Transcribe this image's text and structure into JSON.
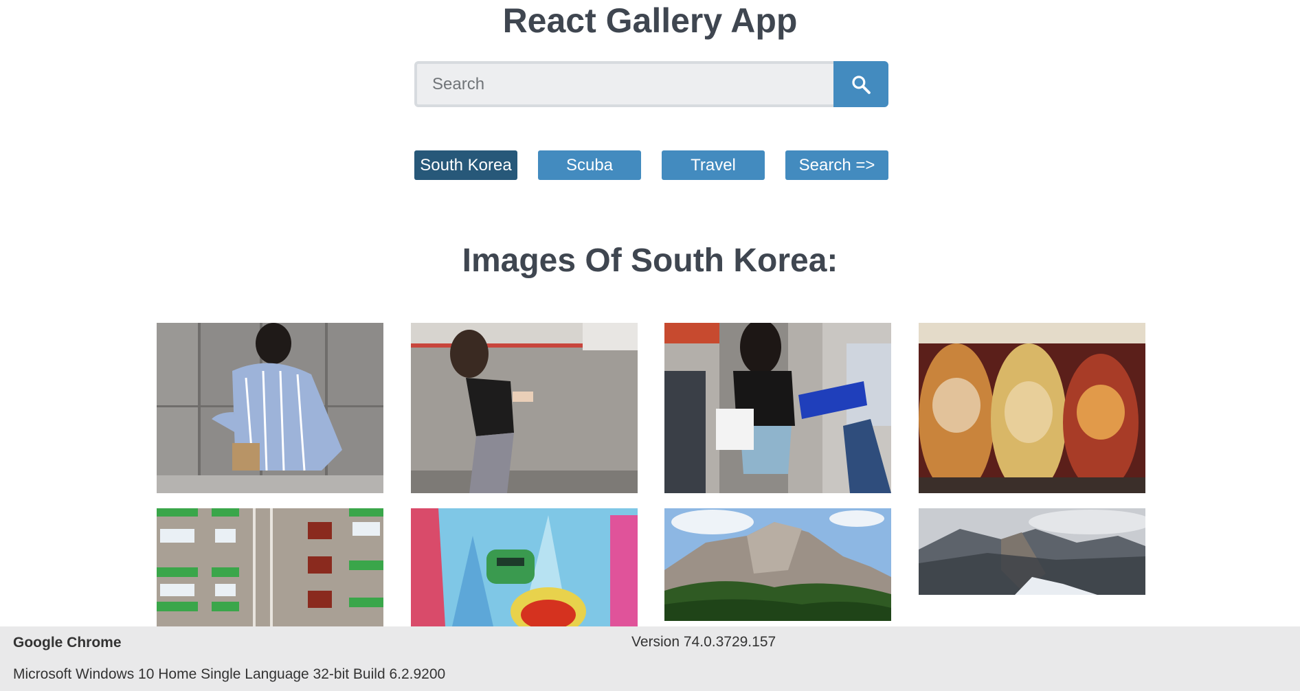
{
  "app": {
    "title": "React Gallery App"
  },
  "search": {
    "placeholder": "Search",
    "value": "",
    "button_icon": "search-icon"
  },
  "nav": {
    "items": [
      {
        "label": "South Korea",
        "active": true
      },
      {
        "label": "Scuba",
        "active": false
      },
      {
        "label": "Travel",
        "active": false
      },
      {
        "label": "Search =>",
        "active": false
      }
    ]
  },
  "gallery": {
    "title": "Images Of South Korea:",
    "photos": [
      {
        "subject": "woman in striped shirt walking"
      },
      {
        "subject": "woman looking at phone"
      },
      {
        "subject": "woman on phone with shopping bag"
      },
      {
        "subject": "painted nesting dolls"
      },
      {
        "subject": "apartment building facade"
      },
      {
        "subject": "colorful city mural"
      },
      {
        "subject": "rocky mountain peak"
      },
      {
        "subject": "mountain panorama"
      }
    ]
  },
  "colors": {
    "accent": "#438bbf",
    "active_nav": "#275879",
    "title_text": "#3f4650",
    "footer_bg": "#e9e9ea"
  },
  "footer": {
    "app_name": "Google Chrome",
    "version": "Version 74.0.3729.157",
    "os": "Microsoft Windows 10 Home Single Language 32-bit Build 6.2.9200"
  }
}
